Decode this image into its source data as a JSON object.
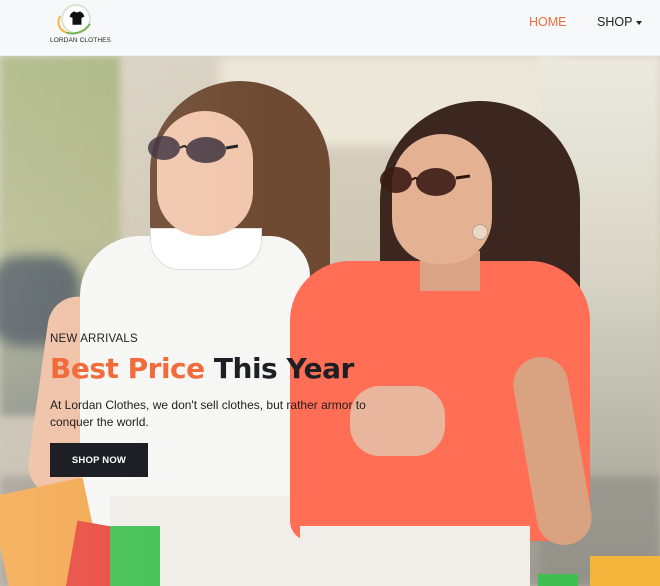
{
  "brand": {
    "logo_text": "LORDAN CLOTHES",
    "logo_icon": "shirt-icon",
    "colors": {
      "accent": "#f26b3a",
      "dark": "#1e1f24"
    }
  },
  "nav": {
    "home_label": "HOME",
    "shop_label": "SHOP"
  },
  "hero": {
    "eyebrow": "NEW ARRIVALS",
    "headline_accent": "Best Price",
    "headline_rest": "This Year",
    "subtext": "At Lordan Clothes, we don't sell clothes, but rather armor to conquer the world.",
    "cta_label": "SHOP NOW"
  }
}
